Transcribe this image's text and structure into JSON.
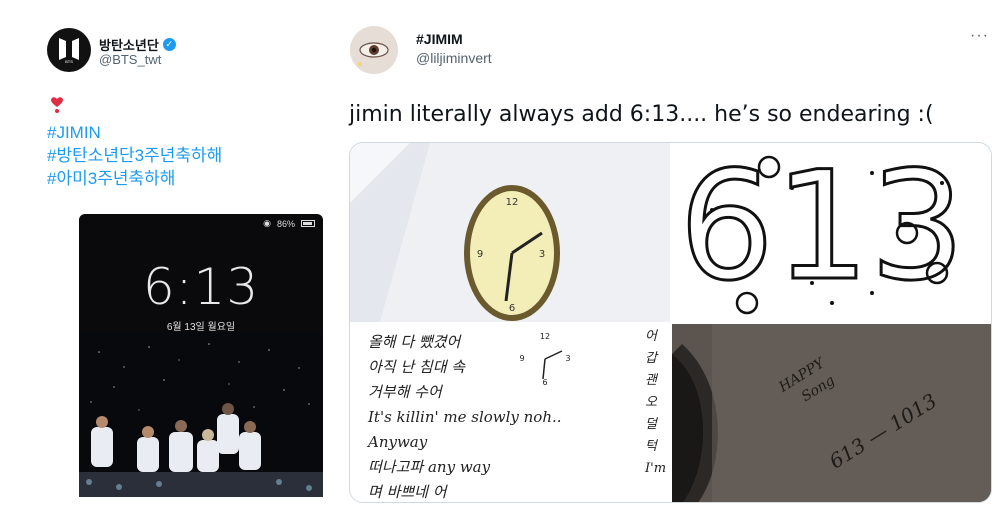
{
  "left_tweet": {
    "display_name": "방탄소년단",
    "handle": "@BTS_twt",
    "avatar_icon": "bts-logo",
    "emoji": "heart-exclamation",
    "hashtags": [
      "#JIMIN",
      "#방탄소년단3주년축하해",
      "#아미3주년축하해"
    ],
    "phone": {
      "battery": "86%",
      "time": "6:13",
      "date": "6월 13일 월요일"
    }
  },
  "right_tweet": {
    "display_name": "#JIMIM",
    "handle": "@liljiminvert",
    "more_icon": "···",
    "text": "jimin literally always add 6:13.... he’s so endearing :(",
    "media": {
      "img2_text": "613",
      "img3_lines": [
        "올해 다 뺐겼어",
        "아직 난 침대 속",
        "거부해 수어",
        "It's killin' me slowly noh..",
        "Anyway",
        "떠나고파 any way",
        "며 바쁘네 어"
      ],
      "img3_side": [
        "어",
        "갑",
        "괜",
        "오",
        "덜",
        "턱",
        "I'm"
      ],
      "img4_text": [
        "HAPPY",
        "Song",
        "613 — 1013"
      ]
    }
  },
  "colors": {
    "link": "#1d9bf0",
    "secondary_text": "#536471",
    "border": "#cfd9de"
  }
}
